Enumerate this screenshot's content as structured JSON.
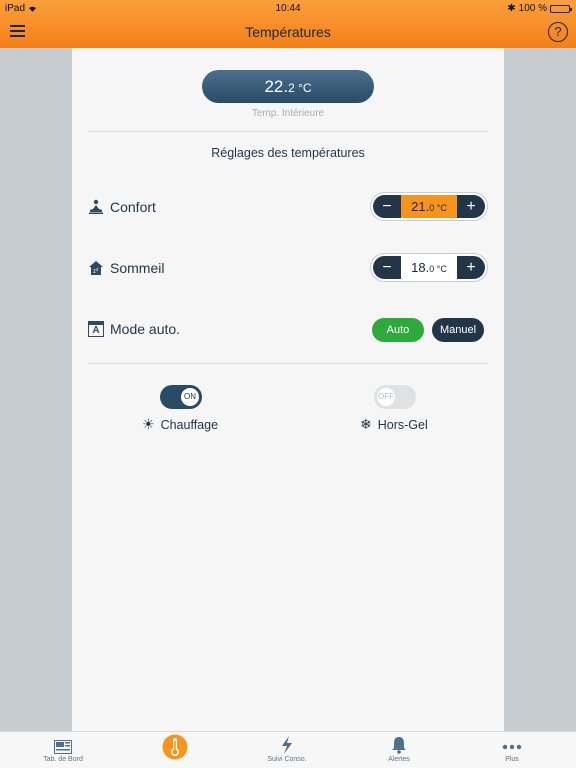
{
  "status_bar": {
    "device": "iPad",
    "time": "10:44",
    "battery": "100 %"
  },
  "header": {
    "title": "Températures",
    "help": "?"
  },
  "indoor": {
    "value": "22.",
    "decimal": "2 °C",
    "caption": "Temp. Intérieure"
  },
  "settings": {
    "title": "Réglages des températures",
    "confort": {
      "label": "Confort",
      "value": "21.",
      "decimal": "0 °C",
      "minus": "−",
      "plus": "+"
    },
    "sommeil": {
      "label": "Sommeil",
      "value": "18.",
      "decimal": "0 °C",
      "minus": "−",
      "plus": "+"
    },
    "mode": {
      "label": "Mode auto.",
      "icon_letter": "A",
      "auto": "Auto",
      "manuel": "Manuel"
    }
  },
  "toggles": {
    "chauffage": {
      "state": "ON",
      "label": "Chauffage"
    },
    "horsgel": {
      "state": "OFF",
      "label": "Hors-Gel"
    }
  },
  "tabs": [
    {
      "label": "Tab. de Bord",
      "icon": "dashboard-icon"
    },
    {
      "label": "",
      "icon": "thermometer-icon"
    },
    {
      "label": "Suivi Conso.",
      "icon": "lightning-icon"
    },
    {
      "label": "Alertes",
      "icon": "bell-icon"
    },
    {
      "label": "Plus",
      "icon": "more-icon"
    }
  ],
  "colors": {
    "orange": "#f7941d",
    "navy": "#233649",
    "green": "#2fa93c",
    "slate": "#2a4b66"
  }
}
